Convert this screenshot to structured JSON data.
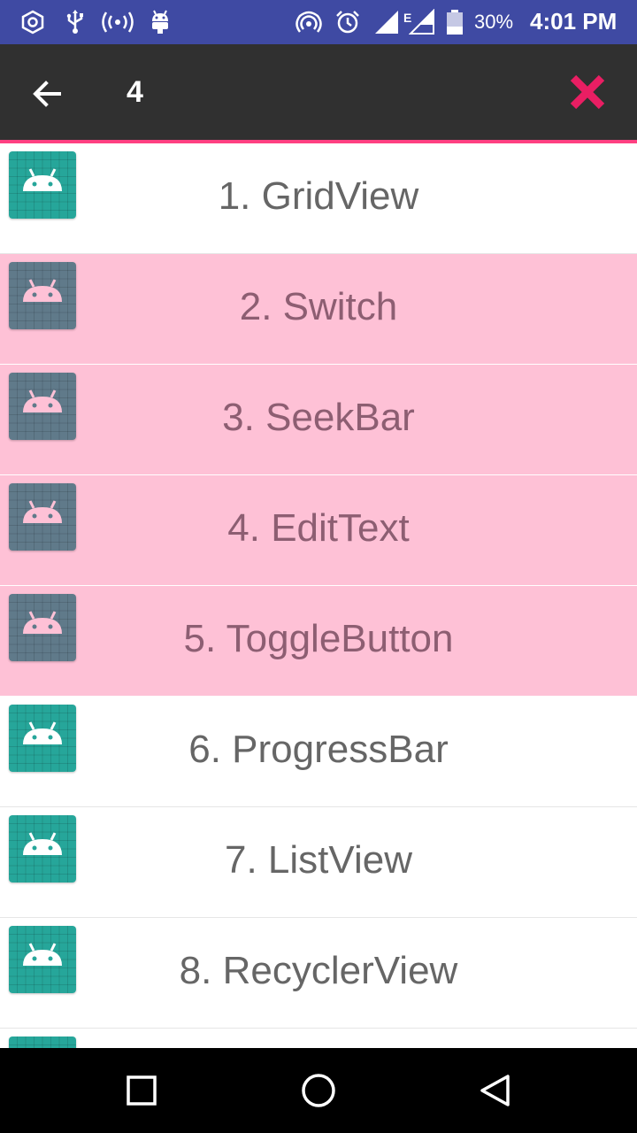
{
  "status_bar": {
    "battery_text": "30%",
    "time": "4:01 PM",
    "network_type": "E",
    "icons": [
      "chrome-icon",
      "usb-icon",
      "hotspot-icon",
      "android-debug-icon",
      "wifi-hotspot-icon",
      "alarm-icon",
      "signal-icon",
      "signal-icon-2",
      "battery-icon"
    ]
  },
  "toolbar": {
    "title": "4",
    "back_icon": "arrow-back-icon",
    "close_icon": "close-icon",
    "background_color": "#303030",
    "accent_color": "#ff4081"
  },
  "list": {
    "items": [
      {
        "label": "1. GridView",
        "selected": false
      },
      {
        "label": "2. Switch",
        "selected": true
      },
      {
        "label": "3. SeekBar",
        "selected": true
      },
      {
        "label": "4. EditText",
        "selected": true
      },
      {
        "label": "5. ToggleButton",
        "selected": true
      },
      {
        "label": "6. ProgressBar",
        "selected": false
      },
      {
        "label": "7. ListView",
        "selected": false
      },
      {
        "label": "8. RecyclerView",
        "selected": false
      },
      {
        "label": "",
        "selected": false
      }
    ],
    "selected_color": "#fec1d6",
    "icon_color": "#26a69a",
    "icon_selected_color": "#607a8a"
  },
  "nav_bar": {
    "buttons": [
      "recents-icon",
      "home-icon",
      "back-icon"
    ]
  }
}
